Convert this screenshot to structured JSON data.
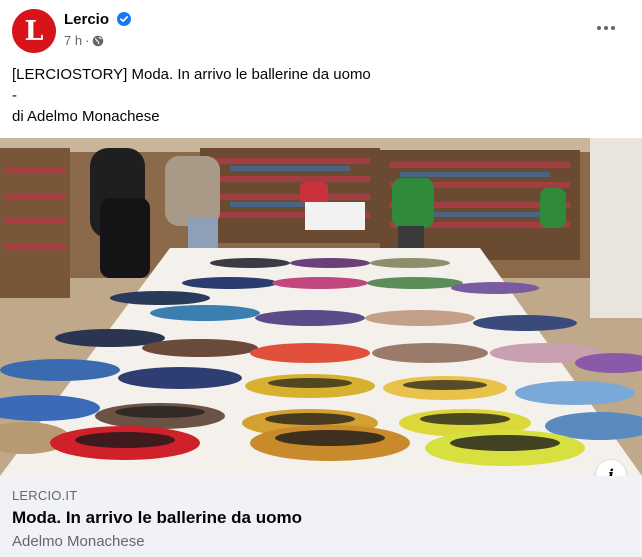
{
  "post": {
    "page_name": "Lercio",
    "avatar_letter": "L",
    "time": "7 h",
    "separator": "·",
    "verified_icon": "verified-badge-icon",
    "audience_icon": "globe-icon",
    "more_icon": "more-options-icon",
    "caption_lines": [
      "[LERCIOSTORY] Moda. In arrivo le ballerine da uomo",
      "-",
      "di Adelmo Monachese"
    ]
  },
  "link_preview": {
    "domain": "LERCIO.IT",
    "title": "Moda. In arrivo le ballerine da uomo",
    "description": "Adelmo Monachese",
    "info_icon": "info-icon",
    "info_label": "i"
  },
  "colors": {
    "brand_red": "#d7141a",
    "verified_blue": "#1877f2",
    "secondary_text": "#65676b",
    "link_bg": "#f0f2f5"
  }
}
